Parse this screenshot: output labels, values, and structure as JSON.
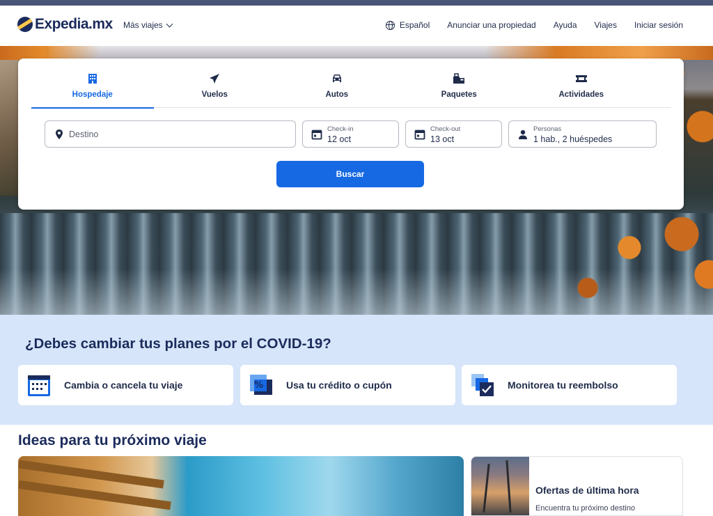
{
  "header": {
    "logo_text": "Expedia.mx",
    "more_trips": "Más viajes",
    "nav": {
      "language": "Español",
      "list_property": "Anunciar una propiedad",
      "help": "Ayuda",
      "trips": "Viajes",
      "sign_in": "Iniciar sesión"
    }
  },
  "search": {
    "tabs": [
      {
        "label": "Hospedaje",
        "icon": "building-icon",
        "active": true
      },
      {
        "label": "Vuelos",
        "icon": "plane-icon",
        "active": false
      },
      {
        "label": "Autos",
        "icon": "car-icon",
        "active": false
      },
      {
        "label": "Paquetes",
        "icon": "package-icon",
        "active": false
      },
      {
        "label": "Actividades",
        "icon": "ticket-icon",
        "active": false
      }
    ],
    "destination_placeholder": "Destino",
    "checkin": {
      "label": "Check-in",
      "value": "12 oct"
    },
    "checkout": {
      "label": "Check-out",
      "value": "13 oct"
    },
    "guests": {
      "label": "Personas",
      "value": "1 hab., 2 huéspedes"
    },
    "button": "Buscar"
  },
  "covid": {
    "title": "¿Debes cambiar tus planes por el COVID-19?",
    "cards": [
      {
        "label": "Cambia o cancela tu viaje",
        "icon": "calendar-icon"
      },
      {
        "label": "Usa tu crédito o cupón",
        "icon": "coupon-icon"
      },
      {
        "label": "Monitorea tu reembolso",
        "icon": "refund-check-icon"
      }
    ]
  },
  "ideas": {
    "title": "Ideas para tu próximo viaje",
    "card_small": {
      "title": "Ofertas de última hora",
      "subtitle": "Encuentra tu próximo destino"
    }
  },
  "colors": {
    "brand_navy": "#1b2b5c",
    "accent_blue": "#1668e3",
    "covid_bg": "#d6e5f9",
    "logo_yellow": "#ffc94a"
  }
}
